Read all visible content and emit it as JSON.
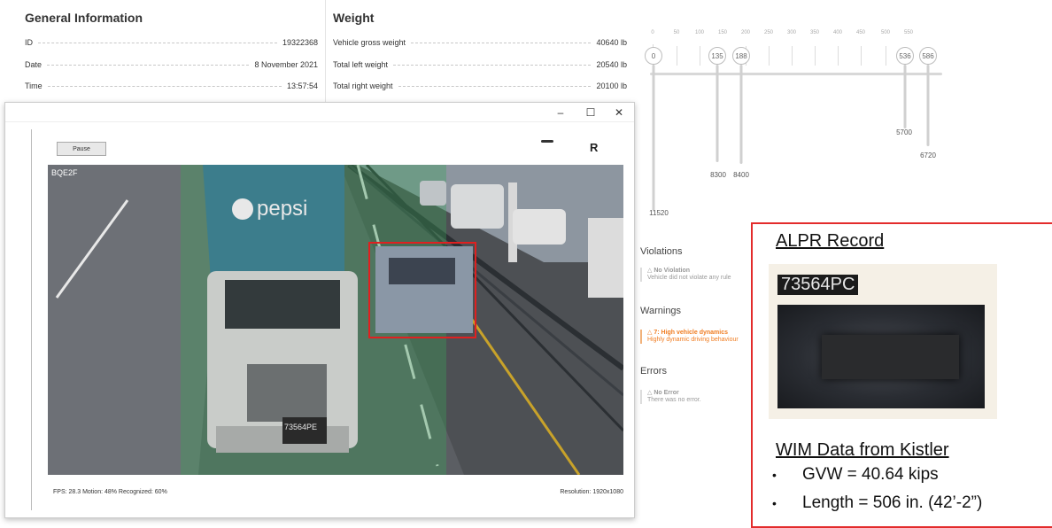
{
  "general": {
    "title": "General Information",
    "rows": [
      {
        "label": "ID",
        "value": "19322368"
      },
      {
        "label": "Date",
        "value": "8 November 2021"
      },
      {
        "label": "Time",
        "value": "13:57:54"
      }
    ]
  },
  "weight": {
    "title": "Weight",
    "rows": [
      {
        "label": "Vehicle gross weight",
        "value": "40640 lb"
      },
      {
        "label": "Total left weight",
        "value": "20540 lb"
      },
      {
        "label": "Total right weight",
        "value": "20100 lb"
      }
    ]
  },
  "axle_diagram": {
    "ticks": [
      "0",
      "50",
      "100",
      "150",
      "200",
      "250",
      "300",
      "350",
      "400",
      "450",
      "500",
      "550"
    ],
    "axles": [
      {
        "position": "0",
        "weight": "11520"
      },
      {
        "position": "135",
        "weight": "8300"
      },
      {
        "position": "188",
        "weight": "8400"
      },
      {
        "position": "536",
        "weight": "5700"
      },
      {
        "position": "586",
        "weight": "6720"
      }
    ]
  },
  "status": {
    "violations": {
      "title": "Violations",
      "heading": "No Violation",
      "detail": "Vehicle did not violate any rule"
    },
    "warnings": {
      "title": "Warnings",
      "heading": "7: High vehicle dynamics",
      "detail": "Highly dynamic driving behaviour"
    },
    "errors": {
      "title": "Errors",
      "heading": "No Error",
      "detail": "There was no error."
    }
  },
  "window": {
    "controls": {
      "minimize": "–",
      "maximize": "☐",
      "close": "✕"
    },
    "pause_label": "Pause",
    "corner_label": "R",
    "camera_label": "BQE2F",
    "truck_brand": "pepsi",
    "plate_overlay": "73564PE",
    "fps_text": "FPS: 28.3  Motion: 48%  Recognized: 60%",
    "resolution_text": "Resolution: 1920x1080"
  },
  "alpr": {
    "title": "ALPR Record",
    "plate": "73564PC",
    "wim_title": "WIM Data from Kistler",
    "wim_items": [
      "GVW = 40.64 kips",
      "Length = 506 in. (42’-2”)"
    ]
  },
  "colors": {
    "alpr_border": "#e32b2b",
    "warning_orange": "#f07d22",
    "detection_box": "#e02020"
  }
}
